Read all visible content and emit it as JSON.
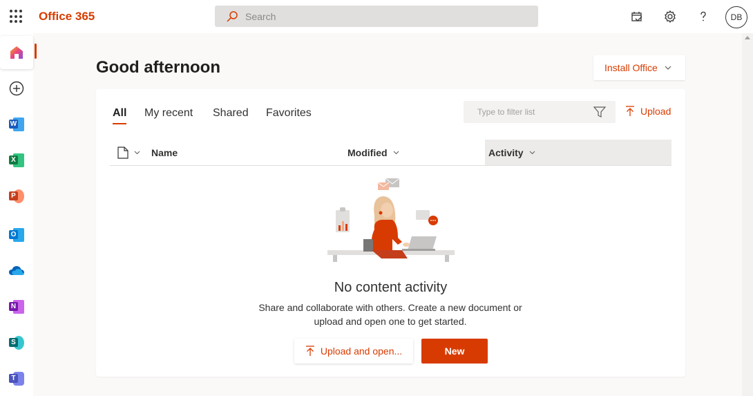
{
  "header": {
    "app_name": "Office 365",
    "search_placeholder": "Search",
    "avatar_initials": "DB"
  },
  "rail": {
    "items": [
      {
        "name": "Home",
        "icon": "home-icon"
      },
      {
        "name": "Create",
        "icon": "plus-circle-icon"
      },
      {
        "name": "Word",
        "letter": "W",
        "color": "#185abd"
      },
      {
        "name": "Excel",
        "letter": "X",
        "color": "#107c41"
      },
      {
        "name": "PowerPoint",
        "letter": "P",
        "color": "#c43e1c"
      },
      {
        "name": "Outlook",
        "letter": "O",
        "color": "#0078d4"
      },
      {
        "name": "OneDrive",
        "icon": "cloud-icon",
        "color": "#0364b8"
      },
      {
        "name": "OneNote",
        "letter": "N",
        "color": "#7719aa"
      },
      {
        "name": "SharePoint",
        "letter": "S",
        "color": "#036c70"
      },
      {
        "name": "Teams",
        "letter": "T",
        "color": "#4b53bc"
      }
    ]
  },
  "main": {
    "greeting": "Good afternoon",
    "install_label": "Install Office",
    "tabs": [
      {
        "label": "All"
      },
      {
        "label": "My recent"
      },
      {
        "label": "Shared"
      },
      {
        "label": "Favorites"
      }
    ],
    "filter_placeholder": "Type to filter list",
    "upload_label": "Upload",
    "columns": {
      "name": "Name",
      "modified": "Modified",
      "activity": "Activity"
    },
    "empty": {
      "title": "No content activity",
      "description": "Share and collaborate with others. Create a new document or upload and open one to get started."
    },
    "buttons": {
      "upload_open": "Upload and open...",
      "new": "New"
    }
  },
  "colors": {
    "accent": "#d83b01",
    "background": "#faf9f8"
  }
}
